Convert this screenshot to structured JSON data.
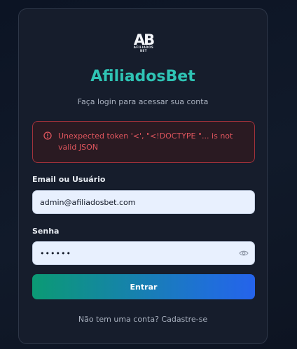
{
  "logo": {
    "letters": "AB",
    "subtext": "AFILIADOS BET"
  },
  "title": "AfiliadosBet",
  "subtitle": "Faça login para acessar sua conta",
  "error": {
    "message": "Unexpected token '<', \"<!DOCTYPE \"... is not valid JSON"
  },
  "form": {
    "email_label": "Email ou Usuário",
    "email_value": "admin@afiliadosbet.com",
    "password_label": "Senha",
    "password_value": "123456",
    "submit_label": "Entrar"
  },
  "signup_text": "Não tem uma conta? Cadastre-se",
  "colors": {
    "brand": "#2fc3b4",
    "error": "#e0565e",
    "button_start": "#0b9a74",
    "button_end": "#2563eb",
    "card": "#161d2c"
  }
}
